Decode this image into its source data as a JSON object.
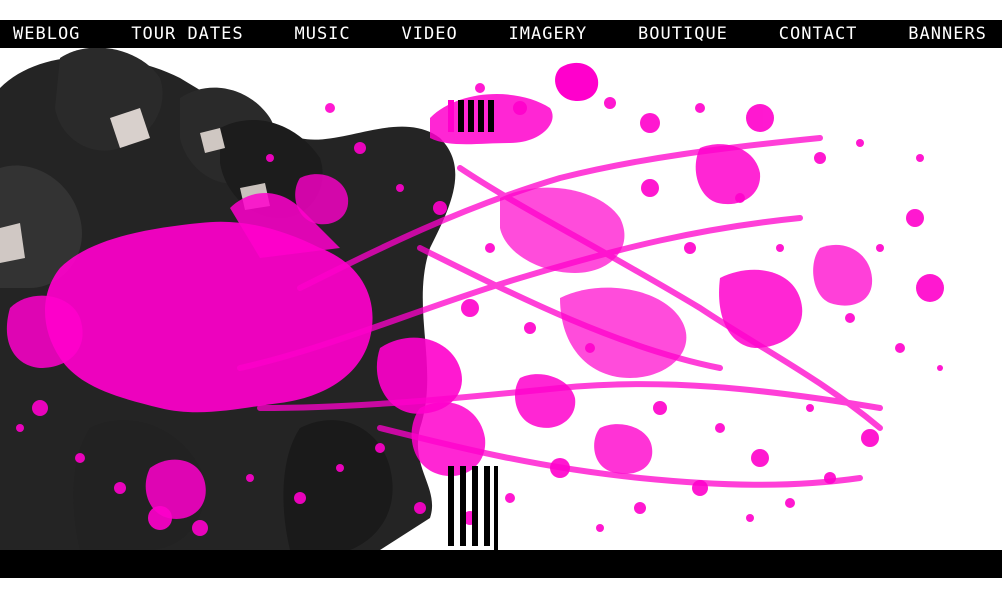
{
  "nav": {
    "items": [
      {
        "label": "WEBLOG"
      },
      {
        "label": "TOUR DATES"
      },
      {
        "label": "MUSIC"
      },
      {
        "label": "VIDEO"
      },
      {
        "label": "IMAGERY"
      },
      {
        "label": "BOUTIQUE"
      },
      {
        "label": "CONTACT"
      },
      {
        "label": "BANNERS"
      }
    ]
  },
  "colors": {
    "bar": "#000000",
    "nav_text": "#ffffff",
    "splatter": "#ff00cc",
    "splatter_deep": "#ff0a88",
    "figures": "#111111"
  }
}
